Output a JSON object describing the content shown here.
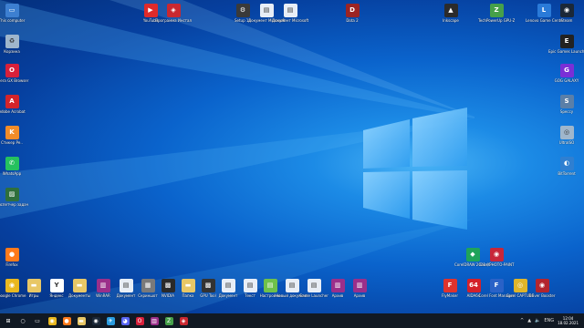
{
  "desktop": {
    "icons_left": [
      {
        "label": "This computer",
        "name": "this-computer",
        "color": "#3d7fd1",
        "sym": "▭"
      },
      {
        "label": "Корзина",
        "name": "recycle-bin",
        "color": "#9fb6cc",
        "sym": "♻"
      },
      {
        "label": "Opera GX Browser",
        "name": "opera-gx",
        "color": "#d8203b",
        "sym": "O"
      },
      {
        "label": "Adobe Acrobat",
        "name": "adobe-acrobat",
        "color": "#d3242a",
        "sym": "A"
      },
      {
        "label": "Стикер Ре..",
        "name": "sticker-app",
        "color": "#f28c28",
        "sym": "K"
      },
      {
        "label": "WhatsApp",
        "name": "whatsapp",
        "color": "#25c15e",
        "sym": "✆"
      },
      {
        "label": "Диспетчер задач",
        "name": "task-manager",
        "color": "#2f6f3c",
        "sym": "▨"
      },
      {
        "label": "Firefox",
        "name": "firefox",
        "color": "#ff7a1a",
        "sym": "●"
      }
    ],
    "icons_right": [
      {
        "label": "Steam",
        "name": "steam",
        "color": "#1b2838",
        "sym": "◉"
      },
      {
        "label": "Epic Games Launcher",
        "name": "epic-games",
        "color": "#222222",
        "sym": "E"
      },
      {
        "label": "GOG GALAXY",
        "name": "gog-galaxy",
        "color": "#7a2fd6",
        "sym": "G"
      },
      {
        "label": "Speccy",
        "name": "speccy",
        "color": "#5a7fa8",
        "sym": "S"
      },
      {
        "label": "UltraISO",
        "name": "ultraiso",
        "color": "#9fb6cc",
        "sym": "◎"
      },
      {
        "label": "BitTorrent",
        "name": "bittorrent",
        "color": "#2f7fd1",
        "sym": "◐"
      }
    ],
    "icons_top": [
      {
        "label": "YouTube",
        "name": "youtube",
        "color": "#e02a2a",
        "sym": "▶"
      },
      {
        "label": "Программа Инсталлятор",
        "name": "installer-app",
        "color": "#c92830",
        "sym": "◈"
      },
      {
        "label": "Setup 11",
        "name": "setup",
        "color": "#3a3a3a",
        "sym": "⚙"
      },
      {
        "label": "Документ Microsoft...",
        "name": "word-doc-1",
        "color": "#e8eef6",
        "sym": "▤"
      },
      {
        "label": "Документ Microsoft...",
        "name": "word-doc-2",
        "color": "#e8eef6",
        "sym": "▤"
      },
      {
        "label": "Dota 2",
        "name": "dota-2",
        "color": "#9b2424",
        "sym": "D"
      },
      {
        "label": "Inkscape",
        "name": "inkscape",
        "color": "#2b2b2b",
        "sym": "▲"
      },
      {
        "label": "TechPowerUp GPU-Z",
        "name": "gpu-z",
        "color": "#46a04a",
        "sym": "Z"
      },
      {
        "label": "Lenovo Game Center",
        "name": "game-center",
        "color": "#2a7ad8",
        "sym": "L"
      }
    ],
    "icons_mid_right": [
      {
        "label": "CorelDRAW 2021 (64-Bit)",
        "name": "coreldraw",
        "color": "#1fa35a",
        "sym": "◆"
      },
      {
        "label": "Corel PHOTO-PAINT",
        "name": "corel-photopaint",
        "color": "#c8263a",
        "sym": "◉"
      }
    ],
    "icons_bottom": [
      {
        "label": "Google Chrome",
        "name": "chrome",
        "color": "#e9b81f",
        "sym": "◉"
      },
      {
        "label": "Игры",
        "name": "folder-games",
        "color": "#e8c766",
        "sym": "▬"
      },
      {
        "label": "Яндекс",
        "name": "yandex",
        "color": "#ffffff",
        "sym": "Y"
      },
      {
        "label": "Документы",
        "name": "folder-documents",
        "color": "#e8c766",
        "sym": "▬"
      },
      {
        "label": "WinRAR",
        "name": "winrar",
        "color": "#9b2f8a",
        "sym": "▥"
      },
      {
        "label": "Документ",
        "name": "document-1",
        "color": "#e8eef6",
        "sym": "▤"
      },
      {
        "label": "Скриншот",
        "name": "screenshot-1",
        "color": "#7a7a7a",
        "sym": "▦"
      },
      {
        "label": "NVIDIA",
        "name": "nvidia",
        "color": "#2a2a2a",
        "sym": "▩"
      },
      {
        "label": "Папка",
        "name": "folder-2",
        "color": "#e8c766",
        "sym": "▬"
      },
      {
        "label": "GPU Tool",
        "name": "gpu-tool",
        "color": "#333333",
        "sym": "▩"
      },
      {
        "label": "Документ",
        "name": "document-2",
        "color": "#e8eef6",
        "sym": "▤"
      },
      {
        "label": "Текст",
        "name": "text-doc",
        "color": "#e8eef6",
        "sym": "▤"
      },
      {
        "label": "Настройки",
        "name": "settings-doc",
        "color": "#6fc14a",
        "sym": "▤"
      },
      {
        "label": "Новый документ",
        "name": "new-doc",
        "color": "#e8eef6",
        "sym": "▤"
      },
      {
        "label": "Game Launcher",
        "name": "game-launcher",
        "color": "#e8eef6",
        "sym": "▤"
      },
      {
        "label": "Архив",
        "name": "archive-1",
        "color": "#9b2f8a",
        "sym": "▥"
      },
      {
        "label": "Архив",
        "name": "archive-2",
        "color": "#9b2f8a",
        "sym": "▥"
      },
      {
        "label": "FlyMaker",
        "name": "flymaker",
        "color": "#e0332d",
        "sym": "F"
      },
      {
        "label": "AIDA64",
        "name": "aida64",
        "color": "#d4202a",
        "sym": "64"
      },
      {
        "label": "Corel Font Manager",
        "name": "corel-font-manager",
        "color": "#2a62c7",
        "sym": "F"
      },
      {
        "label": "Corel CAPTURE",
        "name": "corel-capture",
        "color": "#e0b52a",
        "sym": "◎"
      },
      {
        "label": "Driver Booster",
        "name": "driver-booster",
        "color": "#b3252d",
        "sym": "◉"
      }
    ]
  },
  "taskbar": {
    "items": [
      {
        "name": "start-icon",
        "color": "#111923",
        "sym": "⊞"
      },
      {
        "name": "search-icon",
        "color": "#111923",
        "sym": "○"
      },
      {
        "name": "task-view-icon",
        "color": "#111923",
        "sym": "▭"
      },
      {
        "name": "chrome-icon",
        "color": "#e9b81f",
        "sym": "◉"
      },
      {
        "name": "firefox-icon",
        "color": "#ff7a1a",
        "sym": "●"
      },
      {
        "name": "explorer-icon",
        "color": "#e8c766",
        "sym": "▬"
      },
      {
        "name": "steam-icon",
        "color": "#1b2838",
        "sym": "◉"
      },
      {
        "name": "telegram-icon",
        "color": "#2a9ce0",
        "sym": "✈"
      },
      {
        "name": "discord-icon",
        "color": "#5865f2",
        "sym": "◕"
      },
      {
        "name": "opera-icon",
        "color": "#d8203b",
        "sym": "O"
      },
      {
        "name": "winrar-icon",
        "color": "#9b2f8a",
        "sym": "▥"
      },
      {
        "name": "gpu-icon",
        "color": "#46a04a",
        "sym": "Z"
      },
      {
        "name": "opera-gx-icon",
        "color": "#c92830",
        "sym": "◈"
      }
    ],
    "tray": {
      "arrow": "^",
      "lang": "ENG",
      "volume": "🔈",
      "network": "▲",
      "time": "12:04",
      "date": "18.02.2021"
    }
  }
}
